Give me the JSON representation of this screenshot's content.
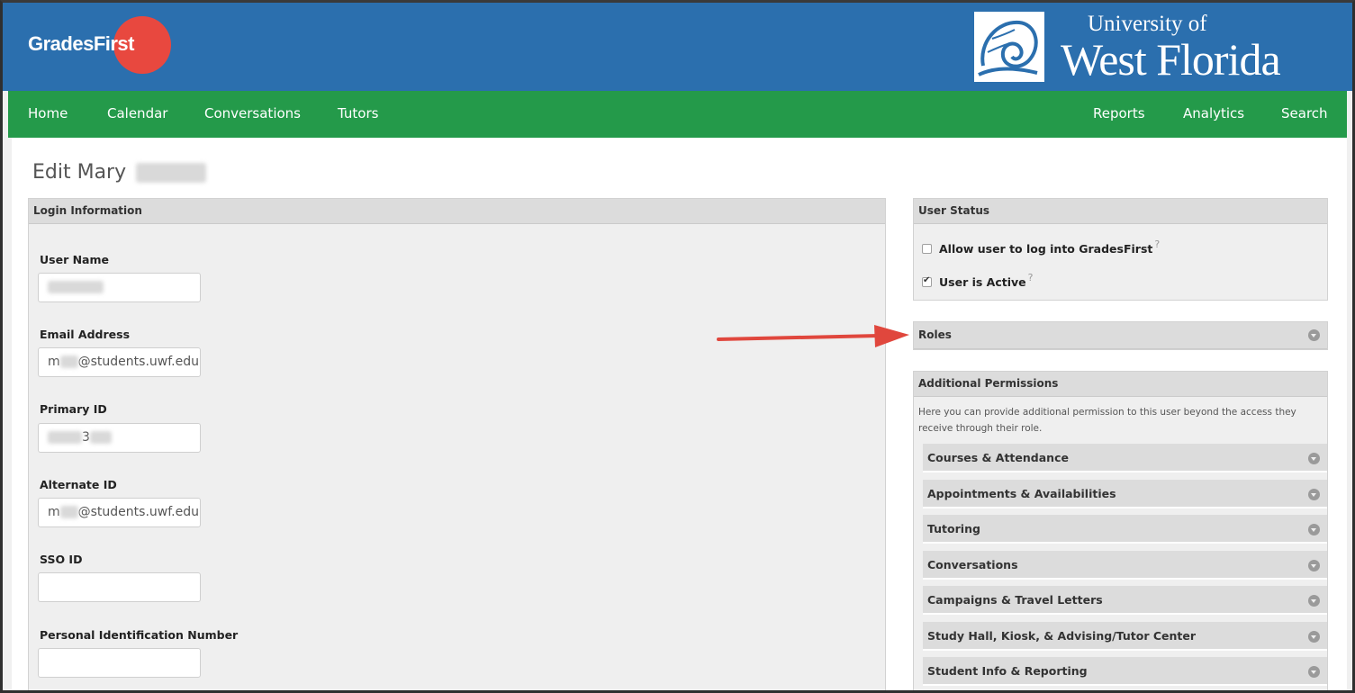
{
  "header": {
    "gf_logo_text": "GradesFirst",
    "uwf_line1": "University of",
    "uwf_line2": "West Florida"
  },
  "nav": {
    "left": [
      "Home",
      "Calendar",
      "Conversations",
      "Tutors"
    ],
    "right": [
      "Reports",
      "Analytics",
      "Search"
    ]
  },
  "page": {
    "title": "Edit Mary"
  },
  "login_panel": {
    "title": "Login Information",
    "fields": [
      {
        "label": "User Name",
        "value": ""
      },
      {
        "label": "Email Address",
        "value_prefix": "m",
        "value_suffix": "@students.uwf.edu"
      },
      {
        "label": "Primary ID",
        "value_mid": "3"
      },
      {
        "label": "Alternate ID",
        "value_prefix": "m",
        "value_suffix": "@students.uwf.edu"
      },
      {
        "label": "SSO ID",
        "value": ""
      },
      {
        "label": "Personal Identification Number",
        "value": ""
      }
    ]
  },
  "user_status": {
    "title": "User Status",
    "allow_login": {
      "label": "Allow user to log into GradesFirst",
      "checked": false
    },
    "active": {
      "label": "User is Active",
      "checked": true
    },
    "help": "?"
  },
  "roles": {
    "title": "Roles"
  },
  "permissions": {
    "title": "Additional Permissions",
    "description": "Here you can provide additional permission to this user beyond the access they receive through their role.",
    "sections": [
      "Courses & Attendance",
      "Appointments & Availabilities",
      "Tutoring",
      "Conversations",
      "Campaigns & Travel Letters",
      "Study Hall, Kiosk, & Advising/Tutor Center",
      "Student Info & Reporting"
    ]
  },
  "colors": {
    "header_blue": "#2b6fae",
    "nav_green": "#249a4a",
    "logo_red": "#e8483f",
    "arrow_red": "#e0473d"
  }
}
